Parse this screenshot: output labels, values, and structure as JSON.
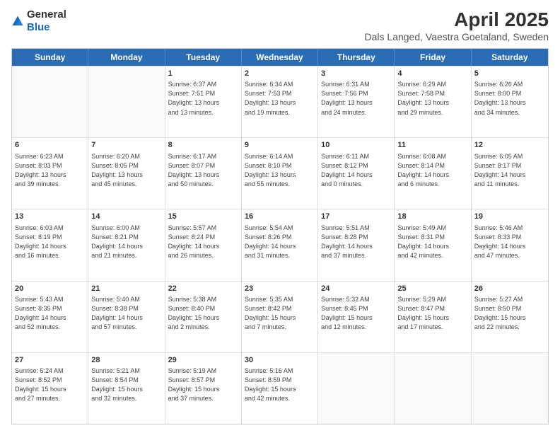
{
  "logo": {
    "general": "General",
    "blue": "Blue"
  },
  "title": "April 2025",
  "subtitle": "Dals Langed, Vaestra Goetaland, Sweden",
  "header_days": [
    "Sunday",
    "Monday",
    "Tuesday",
    "Wednesday",
    "Thursday",
    "Friday",
    "Saturday"
  ],
  "weeks": [
    [
      {
        "day": "",
        "text": ""
      },
      {
        "day": "",
        "text": ""
      },
      {
        "day": "1",
        "text": "Sunrise: 6:37 AM\nSunset: 7:51 PM\nDaylight: 13 hours\nand 13 minutes."
      },
      {
        "day": "2",
        "text": "Sunrise: 6:34 AM\nSunset: 7:53 PM\nDaylight: 13 hours\nand 19 minutes."
      },
      {
        "day": "3",
        "text": "Sunrise: 6:31 AM\nSunset: 7:56 PM\nDaylight: 13 hours\nand 24 minutes."
      },
      {
        "day": "4",
        "text": "Sunrise: 6:29 AM\nSunset: 7:58 PM\nDaylight: 13 hours\nand 29 minutes."
      },
      {
        "day": "5",
        "text": "Sunrise: 6:26 AM\nSunset: 8:00 PM\nDaylight: 13 hours\nand 34 minutes."
      }
    ],
    [
      {
        "day": "6",
        "text": "Sunrise: 6:23 AM\nSunset: 8:03 PM\nDaylight: 13 hours\nand 39 minutes."
      },
      {
        "day": "7",
        "text": "Sunrise: 6:20 AM\nSunset: 8:05 PM\nDaylight: 13 hours\nand 45 minutes."
      },
      {
        "day": "8",
        "text": "Sunrise: 6:17 AM\nSunset: 8:07 PM\nDaylight: 13 hours\nand 50 minutes."
      },
      {
        "day": "9",
        "text": "Sunrise: 6:14 AM\nSunset: 8:10 PM\nDaylight: 13 hours\nand 55 minutes."
      },
      {
        "day": "10",
        "text": "Sunrise: 6:11 AM\nSunset: 8:12 PM\nDaylight: 14 hours\nand 0 minutes."
      },
      {
        "day": "11",
        "text": "Sunrise: 6:08 AM\nSunset: 8:14 PM\nDaylight: 14 hours\nand 6 minutes."
      },
      {
        "day": "12",
        "text": "Sunrise: 6:05 AM\nSunset: 8:17 PM\nDaylight: 14 hours\nand 11 minutes."
      }
    ],
    [
      {
        "day": "13",
        "text": "Sunrise: 6:03 AM\nSunset: 8:19 PM\nDaylight: 14 hours\nand 16 minutes."
      },
      {
        "day": "14",
        "text": "Sunrise: 6:00 AM\nSunset: 8:21 PM\nDaylight: 14 hours\nand 21 minutes."
      },
      {
        "day": "15",
        "text": "Sunrise: 5:57 AM\nSunset: 8:24 PM\nDaylight: 14 hours\nand 26 minutes."
      },
      {
        "day": "16",
        "text": "Sunrise: 5:54 AM\nSunset: 8:26 PM\nDaylight: 14 hours\nand 31 minutes."
      },
      {
        "day": "17",
        "text": "Sunrise: 5:51 AM\nSunset: 8:28 PM\nDaylight: 14 hours\nand 37 minutes."
      },
      {
        "day": "18",
        "text": "Sunrise: 5:49 AM\nSunset: 8:31 PM\nDaylight: 14 hours\nand 42 minutes."
      },
      {
        "day": "19",
        "text": "Sunrise: 5:46 AM\nSunset: 8:33 PM\nDaylight: 14 hours\nand 47 minutes."
      }
    ],
    [
      {
        "day": "20",
        "text": "Sunrise: 5:43 AM\nSunset: 8:35 PM\nDaylight: 14 hours\nand 52 minutes."
      },
      {
        "day": "21",
        "text": "Sunrise: 5:40 AM\nSunset: 8:38 PM\nDaylight: 14 hours\nand 57 minutes."
      },
      {
        "day": "22",
        "text": "Sunrise: 5:38 AM\nSunset: 8:40 PM\nDaylight: 15 hours\nand 2 minutes."
      },
      {
        "day": "23",
        "text": "Sunrise: 5:35 AM\nSunset: 8:42 PM\nDaylight: 15 hours\nand 7 minutes."
      },
      {
        "day": "24",
        "text": "Sunrise: 5:32 AM\nSunset: 8:45 PM\nDaylight: 15 hours\nand 12 minutes."
      },
      {
        "day": "25",
        "text": "Sunrise: 5:29 AM\nSunset: 8:47 PM\nDaylight: 15 hours\nand 17 minutes."
      },
      {
        "day": "26",
        "text": "Sunrise: 5:27 AM\nSunset: 8:50 PM\nDaylight: 15 hours\nand 22 minutes."
      }
    ],
    [
      {
        "day": "27",
        "text": "Sunrise: 5:24 AM\nSunset: 8:52 PM\nDaylight: 15 hours\nand 27 minutes."
      },
      {
        "day": "28",
        "text": "Sunrise: 5:21 AM\nSunset: 8:54 PM\nDaylight: 15 hours\nand 32 minutes."
      },
      {
        "day": "29",
        "text": "Sunrise: 5:19 AM\nSunset: 8:57 PM\nDaylight: 15 hours\nand 37 minutes."
      },
      {
        "day": "30",
        "text": "Sunrise: 5:16 AM\nSunset: 8:59 PM\nDaylight: 15 hours\nand 42 minutes."
      },
      {
        "day": "",
        "text": ""
      },
      {
        "day": "",
        "text": ""
      },
      {
        "day": "",
        "text": ""
      }
    ]
  ]
}
